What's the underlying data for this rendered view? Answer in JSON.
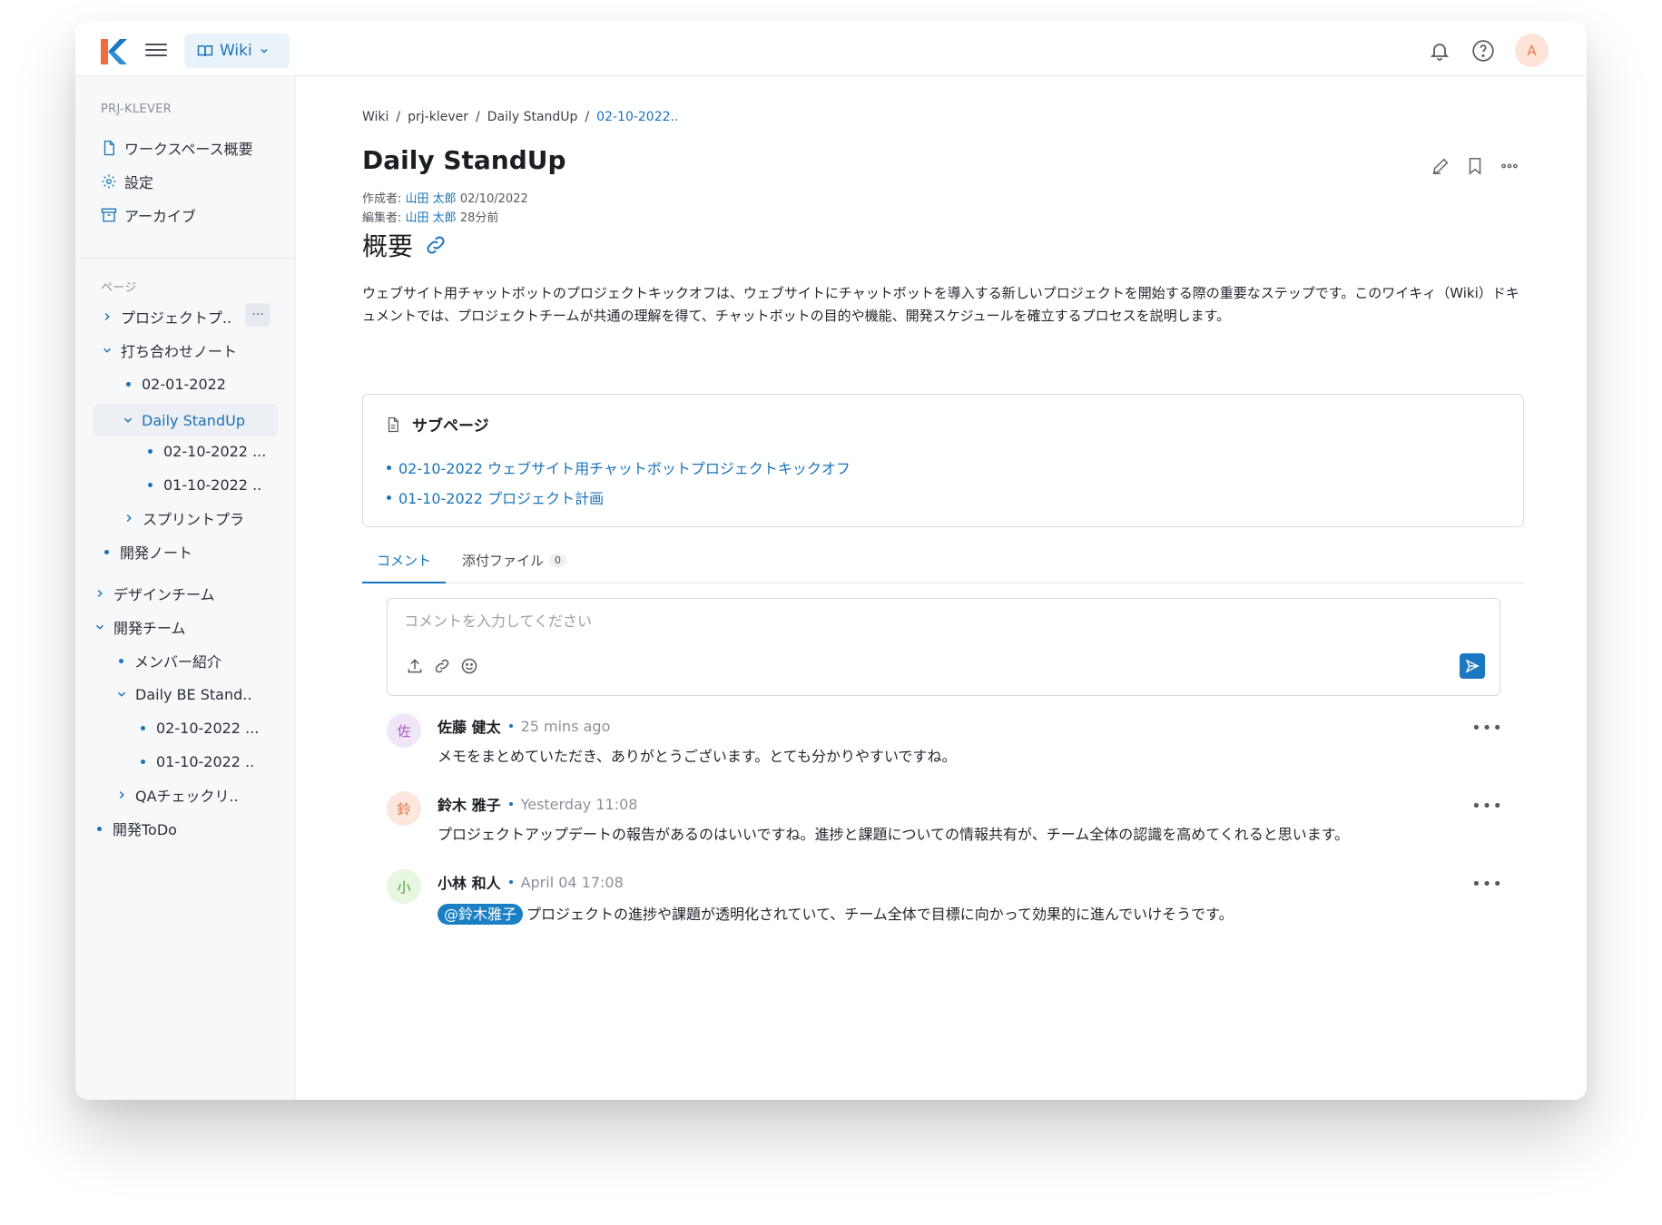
{
  "topbar": {
    "app_button_label": "Wiki",
    "avatar_initial": "A"
  },
  "sidebar": {
    "workspace_label": "PRJ-KLEVER",
    "workspace_items": [
      {
        "label": "ワークスペース概要",
        "icon": "document-icon"
      },
      {
        "label": "設定",
        "icon": "gear-icon"
      },
      {
        "label": "アーカイブ",
        "icon": "archive-icon"
      }
    ],
    "pages_label": "ページ",
    "more_label": "···",
    "tree": [
      {
        "label": "プロジェクトプ..",
        "type": "collapsed"
      },
      {
        "label": "打ち合わせノート",
        "type": "expanded"
      },
      {
        "label": "02-01-2022",
        "type": "leaf"
      },
      {
        "label": "Daily StandUp",
        "type": "expanded",
        "active": true
      },
      {
        "label": "02-10-2022 ...",
        "type": "leaf"
      },
      {
        "label": "01-10-2022 ..",
        "type": "leaf"
      },
      {
        "label": "スプリントプラ",
        "type": "collapsed"
      },
      {
        "label": "開発ノート",
        "type": "leaf"
      },
      {
        "label": "デザインチーム",
        "type": "collapsed"
      },
      {
        "label": "開発チーム",
        "type": "expanded"
      },
      {
        "label": "メンバー紹介",
        "type": "leaf"
      },
      {
        "label": "Daily BE Stand..",
        "type": "expanded"
      },
      {
        "label": "02-10-2022 ...",
        "type": "leaf"
      },
      {
        "label": "01-10-2022 ..",
        "type": "leaf"
      },
      {
        "label": "QAチェックリ..",
        "type": "collapsed"
      },
      {
        "label": "開発ToDo",
        "type": "leaf"
      }
    ]
  },
  "breadcrumb": [
    "Wiki",
    "prj-klever",
    "Daily StandUp",
    "02-10-2022.."
  ],
  "page": {
    "title": "Daily StandUp",
    "author_label": "作成者:",
    "author": "山田 太郎",
    "created": "02/10/2022",
    "editor_label": "編集者:",
    "editor": "山田 太郎",
    "edited": "28分前"
  },
  "overview": {
    "heading": "概要",
    "text": "ウェブサイト用チャットボットのプロジェクトキックオフは、ウェブサイトにチャットボットを導入する新しいプロジェクトを開始する際の重要なステップです。このワイキィ（Wiki）ドキュメントでは、プロジェクトチームが共通の理解を得て、チャットボットの目的や機能、開発スケジュールを確立するプロセスを説明します。"
  },
  "subpages": {
    "heading": "サブページ",
    "items": [
      "02-10-2022 ウェブサイト用チャットボットプロジェクトキックオフ",
      "01-10-2022 プロジェクト計画"
    ]
  },
  "tabs": {
    "comments": "コメント",
    "attachments": "添付ファイル",
    "attachments_count": "0"
  },
  "comment_box": {
    "placeholder": "コメントを入力してください"
  },
  "comments": [
    {
      "initial": "佐",
      "name": "佐藤 健太",
      "time": "25 mins ago",
      "text": "メモをまとめていただき、ありがとうございます。とても分かりやすいですね。",
      "avatar_bg": "#f1e6f8",
      "avatar_fg": "#a45ac2"
    },
    {
      "initial": "鈴",
      "name": "鈴木 雅子",
      "time": "Yesterday 11:08",
      "text": "プロジェクトアップデートの報告があるのはいいですね。進捗と課題についての情報共有が、チーム全体の認識を高めてくれると思います。",
      "avatar_bg": "#fde6dc",
      "avatar_fg": "#e0774c"
    },
    {
      "initial": "小",
      "name": "小林 和人",
      "time": "April 04 17:08",
      "mention": "@鈴木雅子",
      "text": "プロジェクトの進捗や課題が透明化されていて、チーム全体で目標に向かって効果的に進んでいけそうです。",
      "avatar_bg": "#e6f6df",
      "avatar_fg": "#4e9f3d"
    }
  ],
  "colors": {
    "accent": "#1a73b8",
    "sidebar_bg": "#f7f8fa"
  }
}
